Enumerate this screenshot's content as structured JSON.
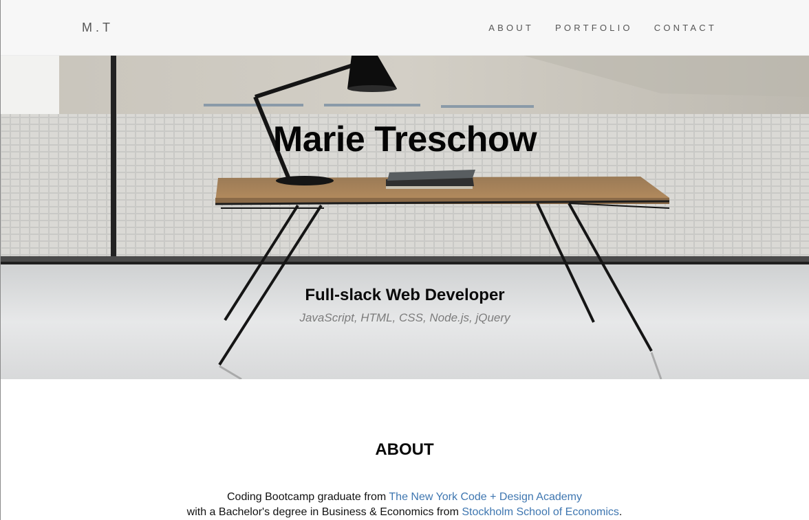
{
  "nav": {
    "brand": "M.T",
    "links": [
      "ABOUT",
      "PORTFOLIO",
      "CONTACT"
    ]
  },
  "hero": {
    "title": "Marie Treschow",
    "subtitle": "Full-slack Web Developer",
    "skills": "JavaScript, HTML, CSS, Node.js, jQuery"
  },
  "about": {
    "heading": "ABOUT",
    "line1_prefix": "Coding Bootcamp graduate from ",
    "line1_link": "The New York Code + Design Academy",
    "line2_prefix": "with a Bachelor's degree in Business & Economics from ",
    "line2_link": "Stockholm School of Economics",
    "line2_suffix": "."
  },
  "colors": {
    "nav_bg": "#f7f7f7",
    "nav_text": "#555555",
    "link_blue": "#3e76b0",
    "skills_gray": "#7c7c7c"
  }
}
